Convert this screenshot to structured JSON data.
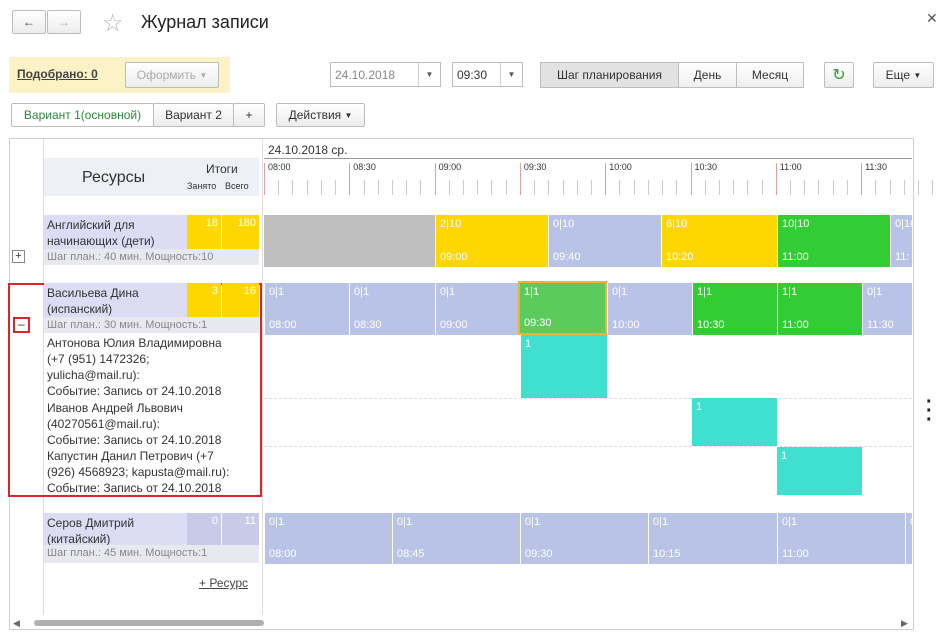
{
  "window": {
    "title": "Журнал записи"
  },
  "toolbar": {
    "selected": "Подобрано: 0",
    "oformit": "Оформить",
    "date": "24.10.2018",
    "time": "09:30",
    "step": "Шаг планирования",
    "day": "День",
    "month": "Месяц",
    "more": "Еще"
  },
  "variants": {
    "v1": "Вариант 1(основной)",
    "v2": "Вариант 2",
    "add": "+",
    "actions": "Действия"
  },
  "grid": {
    "resources_header": "Ресурсы",
    "totals": "Итоги",
    "busy": "Занято",
    "total": "Всего",
    "date_header": "24.10.2018 ср.",
    "ticks": [
      "08:00",
      "08:30",
      "09:00",
      "09:30",
      "10:00",
      "10:30",
      "11:00",
      "11:30"
    ],
    "add_resource": "+ Ресурс"
  },
  "resources": [
    {
      "name1": "Английский для",
      "name2": "начинающих (дети)",
      "meta": "Шаг план.: 40 мин. Мощность:10",
      "busy": "18",
      "total": "180",
      "slots": [
        {
          "a": "2|10",
          "b": "09:00"
        },
        {
          "a": "0|10",
          "b": "09:40"
        },
        {
          "a": "6|10",
          "b": "10:20"
        },
        {
          "a": "10|10",
          "b": "11:00"
        },
        {
          "a": "0|10",
          "b": "11:"
        }
      ]
    },
    {
      "name1": "Васильева  Дина",
      "name2": "(испанский)",
      "meta": "Шаг план.: 30 мин. Мощность:1",
      "busy": "3",
      "total": "16",
      "slots": [
        {
          "a": "0|1",
          "b": "08:00"
        },
        {
          "a": "0|1",
          "b": "08:30"
        },
        {
          "a": "0|1",
          "b": "09:00"
        },
        {
          "a": "1|1",
          "b": "09:30"
        },
        {
          "a": "0|1",
          "b": "10:00"
        },
        {
          "a": "1|1",
          "b": "10:30"
        },
        {
          "a": "1|1",
          "b": "11:00"
        },
        {
          "a": "0|1",
          "b": "11:30"
        }
      ],
      "clients": [
        {
          "l1": "Антонова Юлия Владимировна",
          "l2": "(+7 (951) 1472326;",
          "l3": "yulicha@mail.ru):",
          "l4": "Событие: Запись от 24.10.2018",
          "ev": "1"
        },
        {
          "l1": "Иванов Андрей Львович",
          "l2": "(40270561@mail.ru):",
          "l3": "Событие: Запись от 24.10.2018",
          "ev": "1"
        },
        {
          "l1": "Капустин Данил Петрович (+7",
          "l2": "(926) 4568923; kapusta@mail.ru):",
          "l3": "Событие: Запись от 24.10.2018",
          "ev": "1"
        }
      ]
    },
    {
      "name1": "Серов Дмитрий",
      "name2": "(китайский)",
      "meta": "Шаг план.: 45 мин. Мощность:1",
      "busy": "0",
      "total": "11",
      "slots": [
        {
          "a": "0|1",
          "b": "08:00"
        },
        {
          "a": "0|1",
          "b": "08:45"
        },
        {
          "a": "0|1",
          "b": "09:30"
        },
        {
          "a": "0|1",
          "b": "10:15"
        },
        {
          "a": "0|1",
          "b": "11:00"
        },
        {
          "a": "0",
          "b": ""
        }
      ]
    }
  ]
}
